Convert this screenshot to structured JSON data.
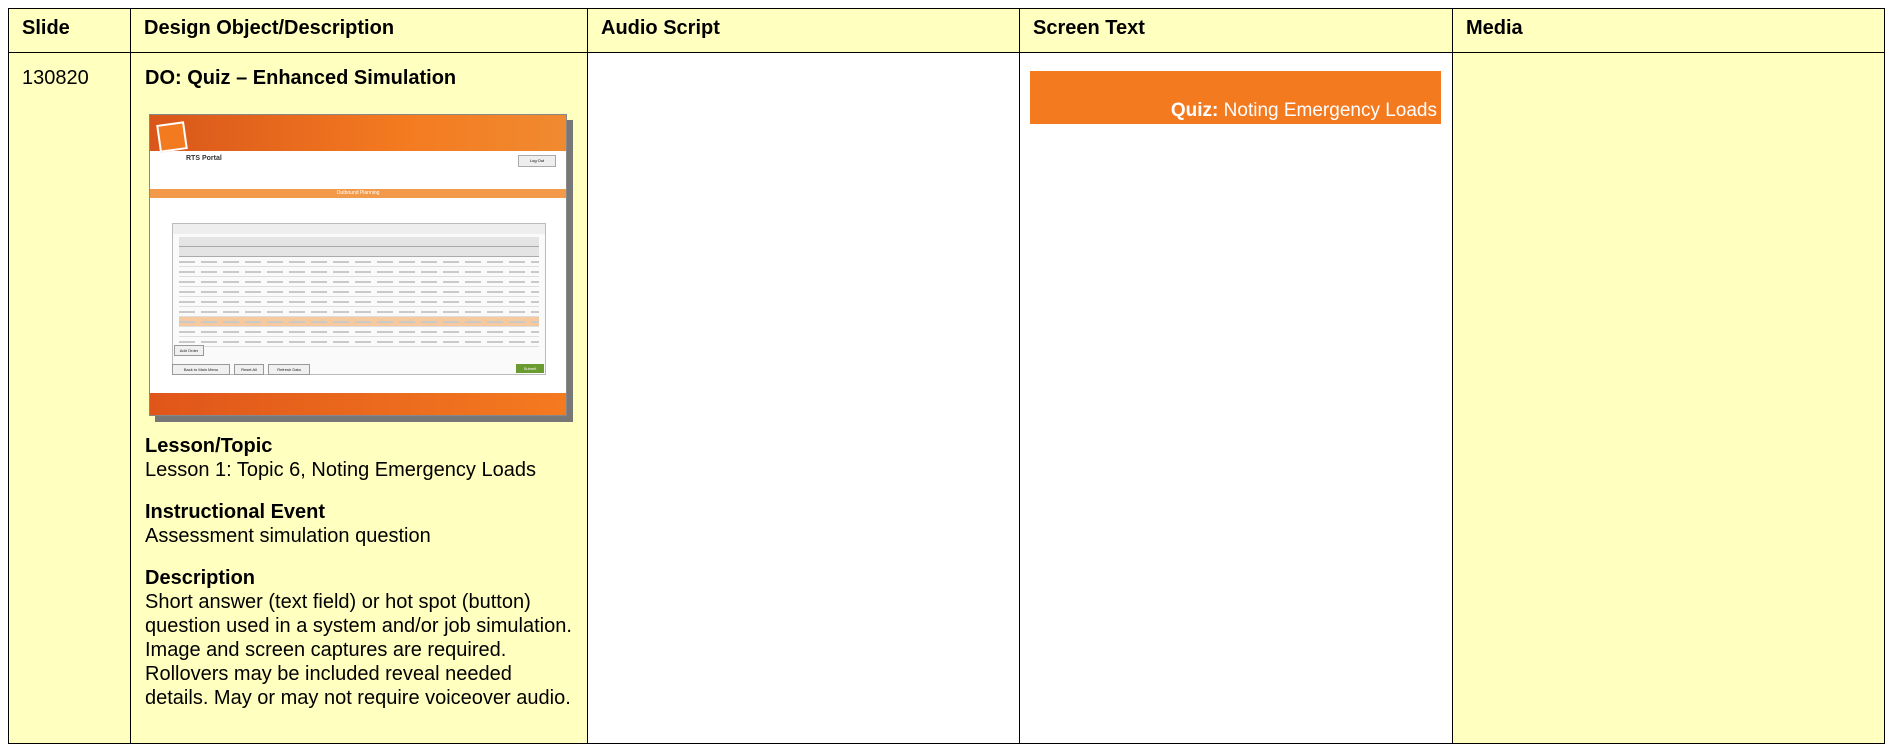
{
  "headers": {
    "slide": "Slide",
    "design": "Design Object/Description",
    "audio": "Audio Script",
    "screen_text": "Screen Text",
    "media": "Media"
  },
  "row": {
    "slide_number": "130820",
    "design_object_title": "DO: Quiz – Enhanced Simulation",
    "sections": [
      {
        "heading": "Lesson/Topic",
        "body": "Lesson 1: Topic 6, Noting Emergency Loads"
      },
      {
        "heading": "Instructional Event",
        "body": "Assessment simulation question"
      },
      {
        "heading": "Description",
        "body": "Short answer (text field) or hot spot (button) question used in a system and/or job simulation. Image and screen captures are required. Rollovers may be included reveal needed details. May or may not require voiceover audio."
      }
    ],
    "screen_text": {
      "quiz_label": "Quiz:",
      "quiz_title": "Noting Emergency Loads"
    },
    "audio_script": "",
    "media": ""
  },
  "thumbnail": {
    "portal_title": "RTS Portal",
    "logout_label": "Log Out",
    "band_label": "Outbound Planning",
    "add_order_label": "Add Order",
    "back_label": "Back to Main Menu",
    "reset_label": "Reset All",
    "refresh_label": "Refresh Data",
    "submit_label": "Submit"
  },
  "colors": {
    "header_bg": "#ffffc0",
    "brand_orange": "#f47a20"
  }
}
